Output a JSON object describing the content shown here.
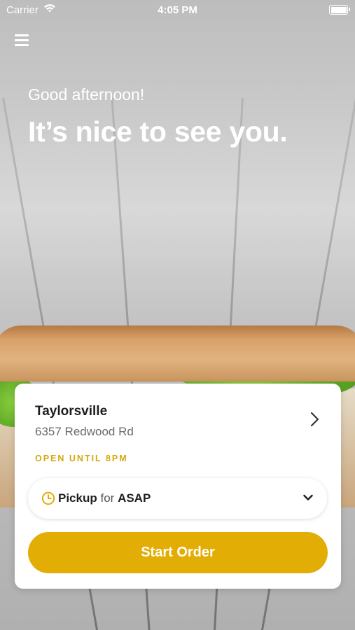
{
  "status_bar": {
    "carrier": "Carrier",
    "time": "4:05 PM",
    "icons": [
      "wifi-icon",
      "battery-icon"
    ]
  },
  "header": {
    "menu_icon": "menu-icon",
    "greeting": "Good afternoon!",
    "headline": "It’s nice to see you."
  },
  "store_card": {
    "store_name": "Taylorsville",
    "address": "6357 Redwood Rd",
    "hours": "OPEN UNTIL 8PM",
    "pickup": {
      "mode": "Pickup",
      "connector": "for",
      "time": "ASAP"
    },
    "start_button": "Start Order"
  },
  "colors": {
    "accent": "#e2ad05",
    "hours_text": "#d4a80c",
    "card_background": "#ffffff"
  }
}
